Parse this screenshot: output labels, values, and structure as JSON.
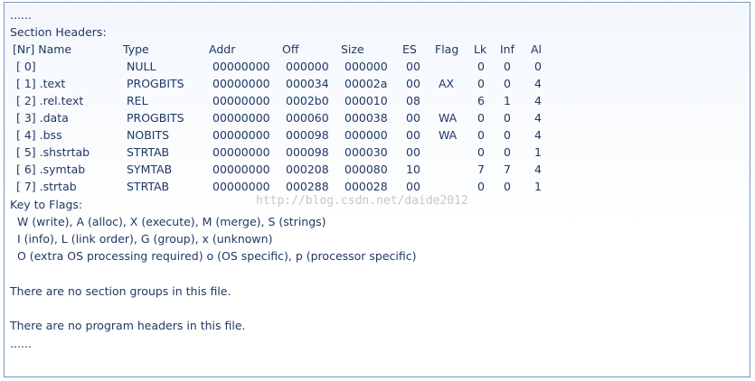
{
  "ellipsis_top": "......",
  "section_headers_title": "Section Headers:",
  "columns": [
    "[Nr] Name",
    "Type",
    "Addr",
    "Off",
    "Size",
    "ES",
    "Flag",
    "Lk",
    "Inf",
    "Al"
  ],
  "rows": [
    [
      "[ 0]",
      "NULL",
      "00000000",
      "000000",
      "000000",
      "00",
      "",
      "0",
      "0",
      "0"
    ],
    [
      "[ 1] .text",
      "PROGBITS",
      "00000000",
      "000034",
      "00002a",
      "00",
      "AX",
      "0",
      "0",
      "4"
    ],
    [
      "[ 2] .rel.text",
      "REL",
      "00000000",
      "0002b0",
      "000010",
      "08",
      "",
      "6",
      "1",
      "4"
    ],
    [
      "[ 3] .data",
      "PROGBITS",
      "00000000",
      "000060",
      "000038",
      "00",
      "WA",
      "0",
      "0",
      "4"
    ],
    [
      "[ 4] .bss",
      "NOBITS",
      "00000000",
      "000098",
      "000000",
      "00",
      "WA",
      "0",
      "0",
      "4"
    ],
    [
      "[ 5] .shstrtab",
      "STRTAB",
      "00000000",
      "000098",
      "000030",
      "00",
      "",
      "0",
      "0",
      "1"
    ],
    [
      "[ 6] .symtab",
      "SYMTAB",
      "00000000",
      "000208",
      "000080",
      "10",
      "",
      "7",
      "7",
      "4"
    ],
    [
      "[ 7] .strtab",
      "STRTAB",
      "00000000",
      "000288",
      "000028",
      "00",
      "",
      "0",
      "0",
      "1"
    ]
  ],
  "key_to_flags": "Key to Flags:",
  "flags_lines": [
    "W (write), A (alloc), X (execute), M (merge), S (strings)",
    "I (info), L (link order), G (group), x (unknown)",
    "O (extra OS processing required) o (OS specific), p (processor specific)"
  ],
  "no_section_groups": "There are no section groups in this file.",
  "no_program_headers": "There are no program headers in this file.",
  "ellipsis_bottom": "......",
  "watermark": "http://blog.csdn.net/daide2012",
  "colors": {
    "text": "#1f3864",
    "border": "#7a96b8",
    "watermark": "#c3c7cf"
  }
}
